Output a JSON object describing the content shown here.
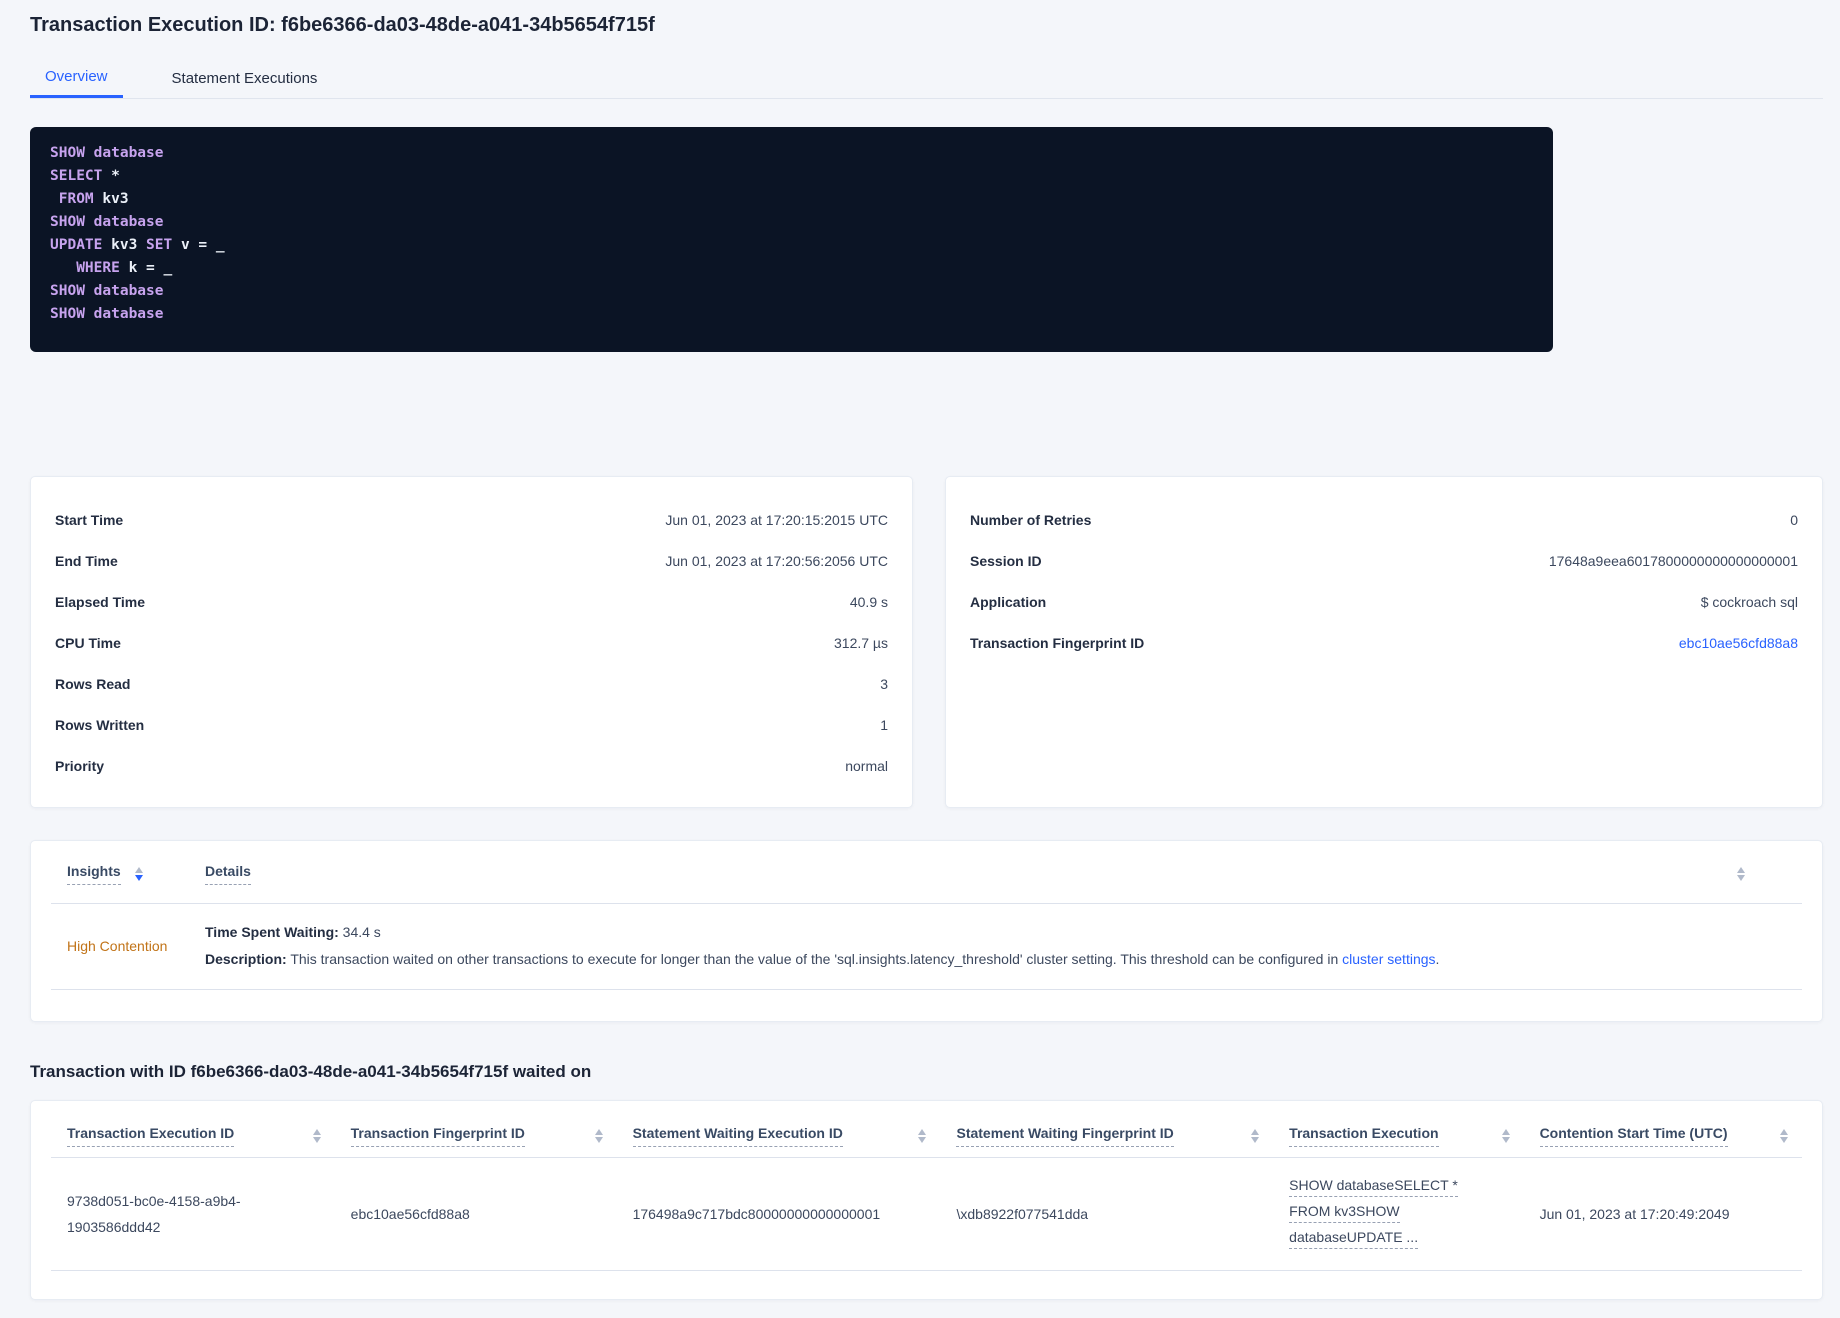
{
  "colors": {
    "accent_blue": "#2962ff",
    "warning_orange": "#c17317",
    "code_background": "#0b1425",
    "code_keyword": "#c7a3ee",
    "code_plain": "#ebf0f8",
    "page_background": "#f4f6fa"
  },
  "icons": {
    "sort": "sort-arrows-icon"
  },
  "page": {
    "title": "Transaction Execution ID: f6be6366-da03-48de-a041-34b5654f715f"
  },
  "tabs": [
    {
      "label": "Overview",
      "active": true
    },
    {
      "label": "Statement Executions",
      "active": false
    }
  ],
  "sql": {
    "lines": [
      [
        {
          "text": "SHOW database",
          "type": "keyword"
        }
      ],
      [
        {
          "text": "SELECT ",
          "type": "keyword"
        },
        {
          "text": "*",
          "type": "plain"
        }
      ],
      [
        {
          "text": " FROM ",
          "type": "keyword"
        },
        {
          "text": "kv3",
          "type": "plain"
        }
      ],
      [
        {
          "text": "SHOW database",
          "type": "keyword"
        }
      ],
      [
        {
          "text": "UPDATE ",
          "type": "keyword"
        },
        {
          "text": "kv3 ",
          "type": "plain"
        },
        {
          "text": "SET ",
          "type": "keyword"
        },
        {
          "text": "v = _",
          "type": "plain"
        }
      ],
      [
        {
          "text": "   WHERE ",
          "type": "keyword"
        },
        {
          "text": "k = _",
          "type": "plain"
        }
      ],
      [
        {
          "text": "SHOW database",
          "type": "keyword"
        }
      ],
      [
        {
          "text": "SHOW database",
          "type": "keyword"
        }
      ]
    ]
  },
  "details_left": {
    "rows": [
      {
        "label": "Start Time",
        "value": "Jun 01, 2023 at 17:20:15:2015 UTC"
      },
      {
        "label": "End Time",
        "value": "Jun 01, 2023 at 17:20:56:2056 UTC"
      },
      {
        "label": "Elapsed Time",
        "value": "40.9 s"
      },
      {
        "label": "CPU Time",
        "value": "312.7 µs"
      },
      {
        "label": "Rows Read",
        "value": "3"
      },
      {
        "label": "Rows Written",
        "value": "1"
      },
      {
        "label": "Priority",
        "value": "normal"
      }
    ]
  },
  "details_right": {
    "rows": [
      {
        "label": "Number of Retries",
        "value": "0"
      },
      {
        "label": "Session ID",
        "value": "17648a9eea6017800000000000000001"
      },
      {
        "label": "Application",
        "value": "$ cockroach sql"
      },
      {
        "label": "Transaction Fingerprint ID",
        "value": "ebc10ae56cfd88a8"
      }
    ]
  },
  "insights": {
    "columns": [
      "Insights",
      "Details"
    ],
    "row": {
      "insight": "High Contention",
      "waiting_label": "Time Spent Waiting:",
      "waiting_value": " 34.4 s",
      "description_label": "Description:",
      "description_text": " This transaction waited on other transactions to execute for longer than the value of the 'sql.insights.latency_threshold' cluster setting. This threshold can be configured in ",
      "description_link": "cluster settings",
      "description_suffix": "."
    }
  },
  "waited_on": {
    "heading": "Transaction with ID f6be6366-da03-48de-a041-34b5654f715f waited on",
    "columns": [
      "Transaction Execution ID",
      "Transaction Fingerprint ID",
      "Statement Waiting Execution ID",
      "Statement Waiting Fingerprint ID",
      "Transaction Execution",
      "Contention Start Time (UTC)"
    ],
    "row": {
      "txn_execution_id": "9738d051-bc0e-4158-a9b4-1903586ddd42",
      "txn_fingerprint_id": "ebc10ae56cfd88a8",
      "stmt_waiting_execution_id": "176498a9c717bdc80000000000000001",
      "stmt_waiting_fingerprint_id": "\\xdb8922f077541dda",
      "transaction_execution_lines": [
        "SHOW databaseSELECT *",
        "FROM kv3SHOW",
        "databaseUPDATE ..."
      ],
      "contention_start_time": "Jun 01, 2023 at 17:20:49:2049"
    }
  }
}
